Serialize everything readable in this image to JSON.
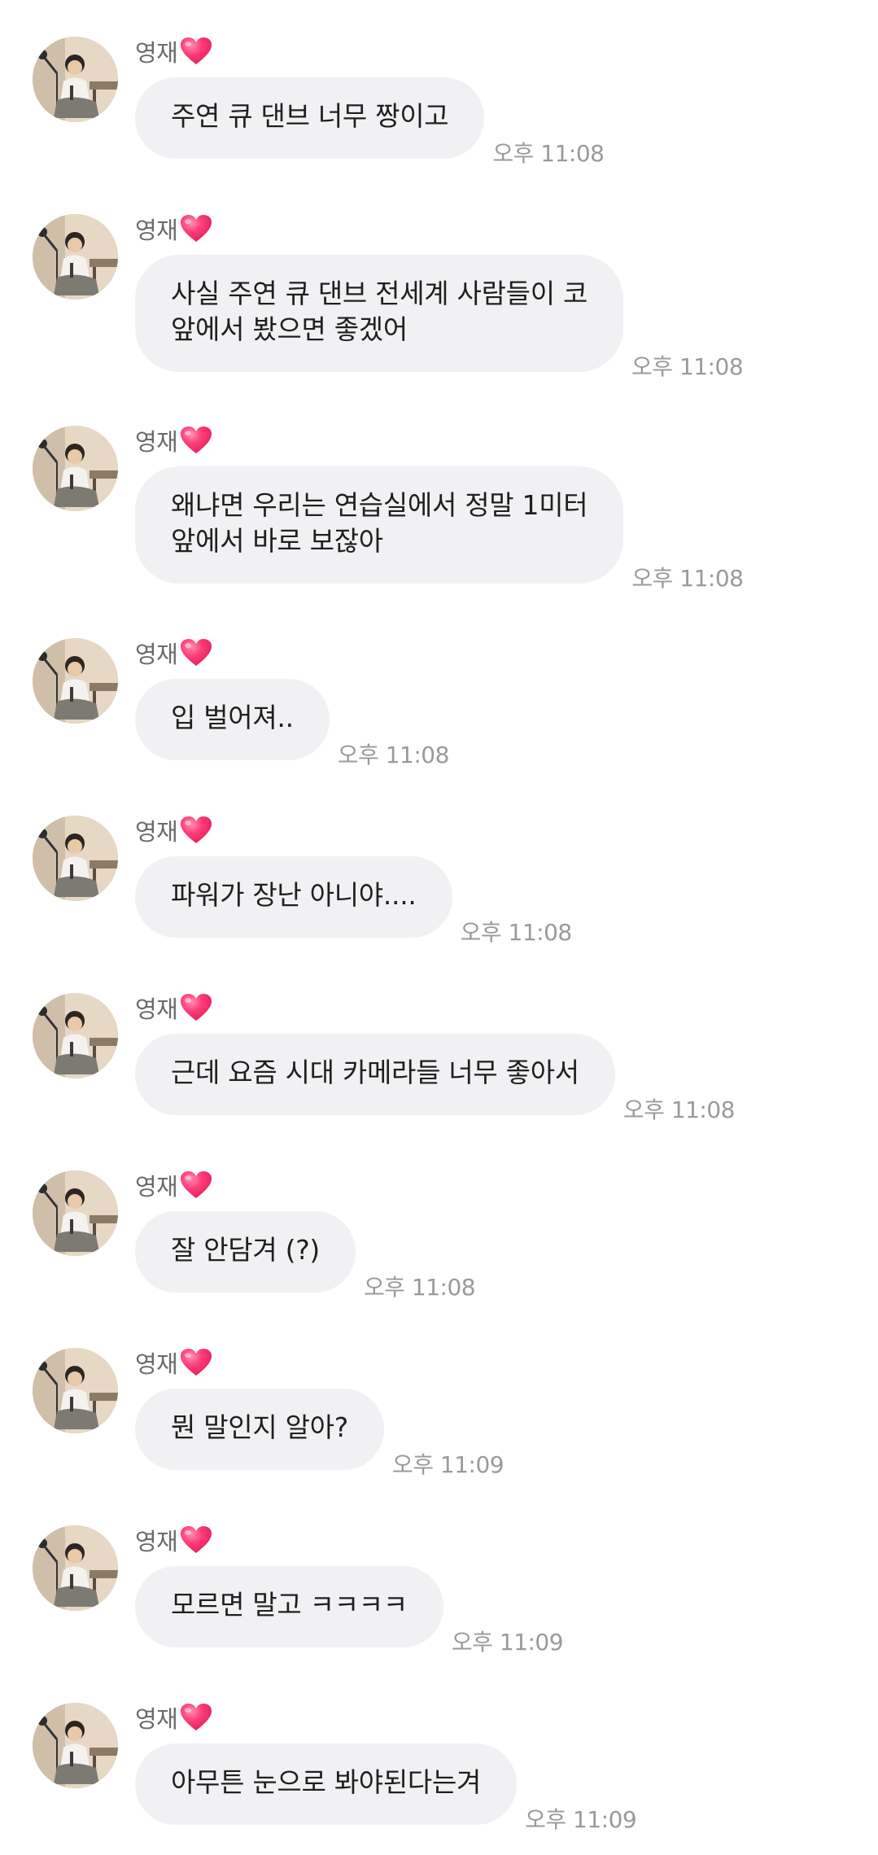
{
  "chat": {
    "sender": "영재",
    "heart_color": "#ff3d78",
    "bubble_color": "#f1f1f3",
    "messages": [
      {
        "text": "주연 큐 댄브 너무 짱이고",
        "time": "오후 11:08"
      },
      {
        "text": "사실 주연 큐 댄브 전세계 사람들이 코\n앞에서 봤으면 좋겠어",
        "time": "오후 11:08"
      },
      {
        "text": "왜냐면 우리는 연습실에서 정말 1미터\n앞에서 바로 보잖아",
        "time": "오후 11:08"
      },
      {
        "text": "입 벌어져..",
        "time": "오후 11:08"
      },
      {
        "text": "파워가 장난 아니야....",
        "time": "오후 11:08"
      },
      {
        "text": "근데 요즘 시대 카메라들 너무 좋아서",
        "time": "오후 11:08"
      },
      {
        "text": "잘 안담겨 (?)",
        "time": "오후 11:08"
      },
      {
        "text": "뭔 말인지 알아?",
        "time": "오후 11:09"
      },
      {
        "text": "모르면 말고 ㅋㅋㅋㅋ",
        "time": "오후 11:09"
      },
      {
        "text": "아무튼 눈으로 봐야된다는겨",
        "time": "오후 11:09"
      }
    ]
  }
}
